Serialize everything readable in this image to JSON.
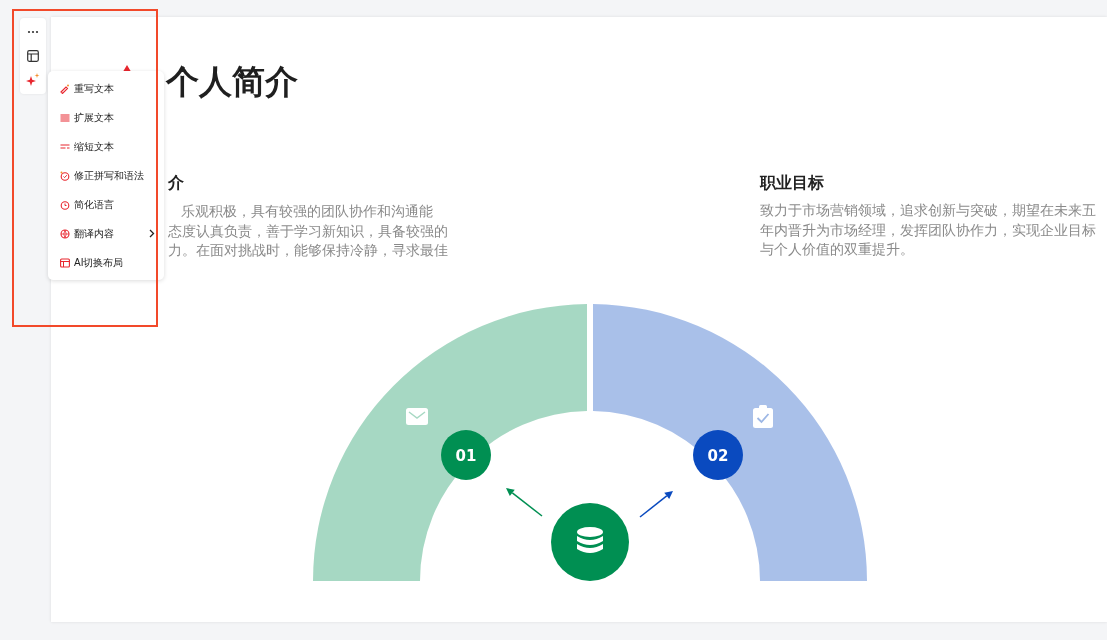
{
  "slide": {
    "title": "个人简介",
    "sections": [
      {
        "heading": "介",
        "lines": [
          "乐观积极，具有较强的团队协作和沟通能",
          "态度认真负责，善于学习新知识，具备较强的",
          "力。在面对挑战时，能够保持冷静，寻求最佳"
        ]
      },
      {
        "heading": "职业目标",
        "text": "致力于市场营销领域，追求创新与突破，期望在未来五年内晋升为市场经理，发挥团队协作力，实现企业目标与个人价值的双重提升。"
      }
    ],
    "diagram": {
      "nodes": [
        {
          "number": "01",
          "color": "#008f52"
        },
        {
          "number": "02",
          "color": "#0a4abf"
        }
      ]
    }
  },
  "ai_menu": {
    "items": [
      {
        "label": "重写文本",
        "has_submenu": false
      },
      {
        "label": "扩展文本",
        "has_submenu": false
      },
      {
        "label": "缩短文本",
        "has_submenu": false
      },
      {
        "label": "修正拼写和语法",
        "has_submenu": false
      },
      {
        "label": "简化语言",
        "has_submenu": false
      },
      {
        "label": "翻译内容",
        "has_submenu": true
      },
      {
        "label": "AI切换布局",
        "has_submenu": false
      }
    ]
  }
}
